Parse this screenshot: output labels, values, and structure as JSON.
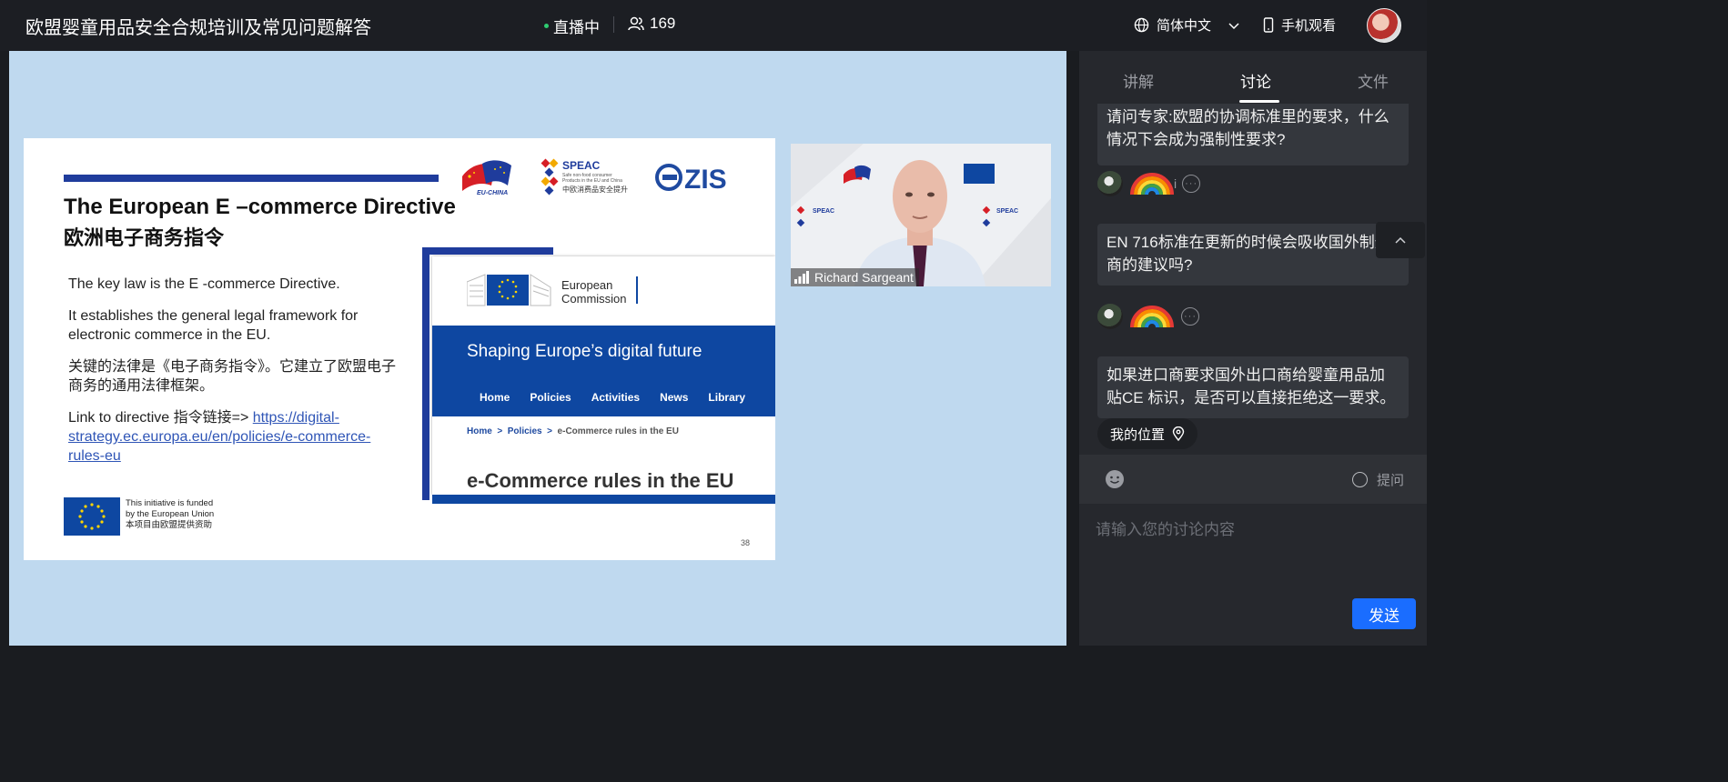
{
  "header": {
    "title": "欧盟婴童用品安全合规培训及常见问题解答",
    "live_label": "直播中",
    "viewer_count": "169",
    "language_label": "简体中文",
    "mobile_label": "手机观看"
  },
  "slide": {
    "title_en": "The European E –commerce Directive",
    "title_zh": "欧洲电子商务指令",
    "para1": "The key law is the E -commerce Directive.",
    "para2": "It establishes the general legal framework for electronic commerce in the EU.",
    "para3": "关键的法律是《电子商务指令》。它建立了欧盟电子商务的通用法律框架。",
    "para4_prefix": "Link to directive 指令链接=> ",
    "para4_link": "https://digital-strategy.ec.europa.eu/en/policies/e-commerce-rules-eu",
    "eu_funding_line1": "This initiative is funded",
    "eu_funding_line2": "by the European Union",
    "eu_funding_line3": "本项目由欧盟提供资助",
    "page_number": "38",
    "logo_euchina": "EU-CHINA",
    "logo_speac": "SPEAC",
    "logo_speac_sub1": "Safe non-food consumer",
    "logo_speac_sub2": "Products in the EU and China",
    "logo_speac_zh": "中欧消费品安全提升",
    "logo_zis": "ZIS",
    "web": {
      "ec_line1": "European",
      "ec_line2": "Commission",
      "banner": "Shaping Europe’s digital future",
      "nav": [
        "Home",
        "Policies",
        "Activities",
        "News",
        "Library"
      ],
      "crumb1": "Home",
      "crumb2": "Policies",
      "crumb3": "e-Commerce rules in the EU",
      "heading": "e-Commerce rules in the EU"
    }
  },
  "video": {
    "speaker_name": "Richard Sargeant"
  },
  "panel": {
    "tabs": [
      "讲解",
      "讨论",
      "文件"
    ],
    "active_tab": "讨论",
    "messages": [
      {
        "text": "请问专家:欧盟的协调标准里的要求，什么情况下会成为强制性要求?",
        "user_initial": "i"
      },
      {
        "text": "EN 716标准在更新的时候会吸收国外制造商的建议吗?"
      },
      {
        "text": "如果进口商要求国外出口商给婴童用品加贴CE 标识，是否可以直接拒绝这一要求。"
      }
    ],
    "my_location": "我的位置",
    "ask_label": "提问",
    "input_placeholder": "请输入您的讨论内容",
    "send_label": "发送"
  },
  "colors": {
    "accent": "#1a6dff",
    "live_dot": "#2ecc71",
    "slide_blue": "#1f3c9c",
    "ec_blue": "#0e47a1"
  }
}
